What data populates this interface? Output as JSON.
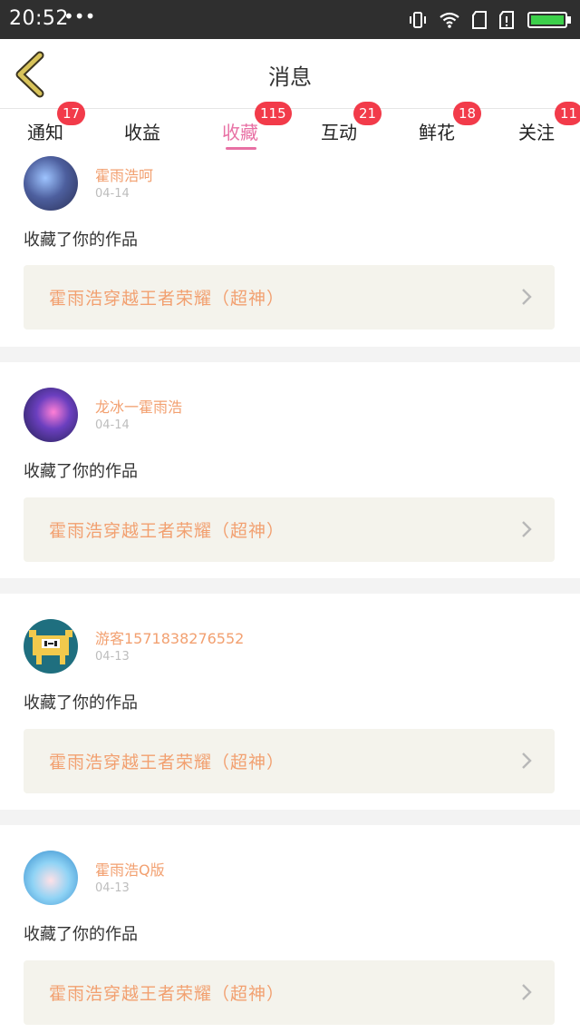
{
  "status_bar": {
    "time": "20:52",
    "dots": "•••",
    "icons": [
      "vibrate-icon",
      "wifi-icon",
      "sim1-icon",
      "sim2-icon",
      "battery-icon"
    ],
    "battery_color": "#3ccf4a"
  },
  "header": {
    "title": "消息",
    "back_icon": "chevron-left-icon",
    "back_color": "#d8c35a"
  },
  "tabs": [
    {
      "label": "通知",
      "badge": "17",
      "active": false
    },
    {
      "label": "收益",
      "badge": "",
      "active": false
    },
    {
      "label": "收藏",
      "badge": "115",
      "active": true
    },
    {
      "label": "互动",
      "badge": "21",
      "active": false
    },
    {
      "label": "鲜花",
      "badge": "18",
      "active": false
    },
    {
      "label": "关注",
      "badge": "11",
      "active": false
    }
  ],
  "colors": {
    "accent_pink": "#e870a4",
    "badge_red": "#f23b4a",
    "name_orange": "#f2a070"
  },
  "messages": [
    {
      "username": "霍雨浩呵",
      "date": "04-14",
      "action": "收藏了你的作品",
      "work_title": "霍雨浩穿越王者荣耀（超神）"
    },
    {
      "username": "龙冰一霍雨浩",
      "date": "04-14",
      "action": "收藏了你的作品",
      "work_title": "霍雨浩穿越王者荣耀（超神）"
    },
    {
      "username": "游客1571838276552",
      "date": "04-13",
      "action": "收藏了你的作品",
      "work_title": "霍雨浩穿越王者荣耀（超神）"
    },
    {
      "username": "霍雨浩Q版",
      "date": "04-13",
      "action": "收藏了你的作品",
      "work_title": "霍雨浩穿越王者荣耀（超神）"
    }
  ]
}
